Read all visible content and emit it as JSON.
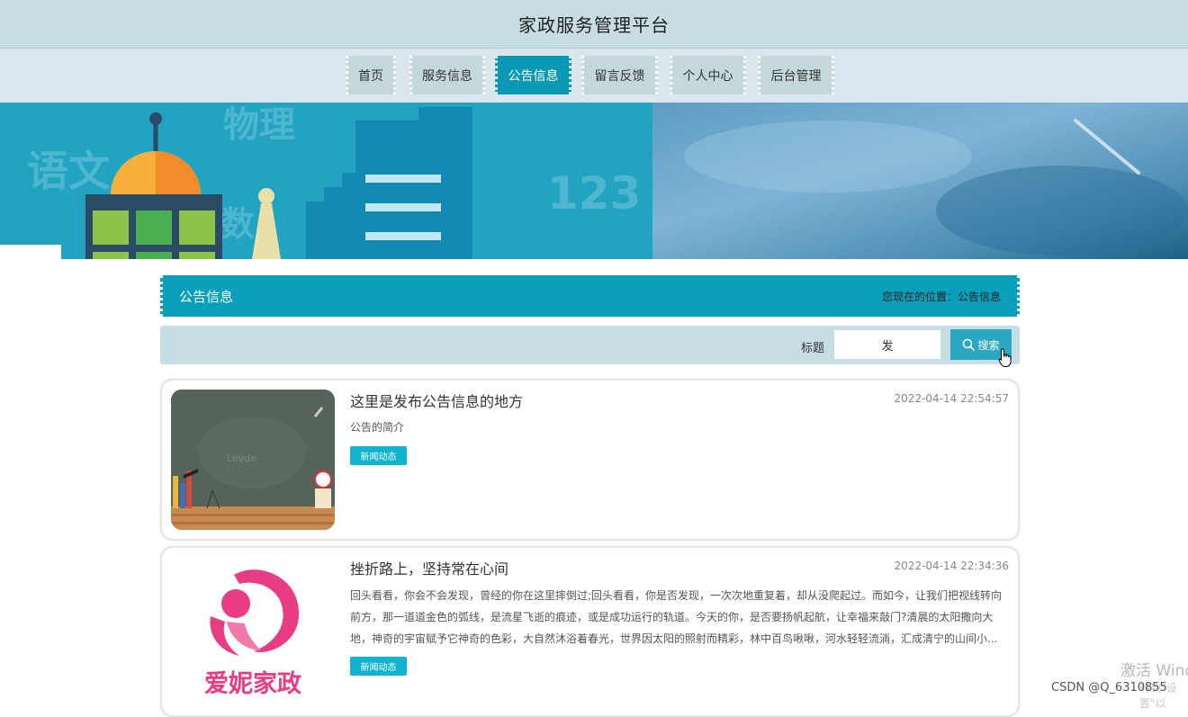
{
  "header": {
    "title": "家政服务管理平台"
  },
  "nav": {
    "items": [
      {
        "label": "首页",
        "active": false
      },
      {
        "label": "服务信息",
        "active": false
      },
      {
        "label": "公告信息",
        "active": true
      },
      {
        "label": "留言反馈",
        "active": false
      },
      {
        "label": "个人中心",
        "active": false
      },
      {
        "label": "后台管理",
        "active": false
      }
    ]
  },
  "banner": {
    "words": [
      "语文",
      "物理",
      "数",
      "123"
    ]
  },
  "section": {
    "title": "公告信息",
    "breadcrumb": "您现在的位置：公告信息"
  },
  "search": {
    "label": "标题",
    "value": "发",
    "button_label": "搜索",
    "button_icon": "search-icon"
  },
  "list": [
    {
      "title": "这里是发布公告信息的地方",
      "time": "2022-04-14 22:54:57",
      "desc": "公告的简介",
      "tag": "新闻动态",
      "thumb": {
        "kind": "classroom-chalkboard",
        "text": "Lovde"
      }
    },
    {
      "title": "挫折路上，坚持常在心间",
      "time": "2022-04-14 22:34:36",
      "desc": "回头看看，你会不会发现，曾经的你在这里摔倒过;回头看看，你是否发现，一次次地重复着，却从没爬起过。而如今，让我们把视线转向前方，那一道道金色的弧线，是流星飞逝的痕迹，或是成功运行的轨道。今天的你，是否要扬帆起航，让幸福来敲门?清晨的太阳撒向大地，神奇的宇宙赋予它神奇的色彩，大自然沐浴着春光，世界因太阳的照射而精彩，林中百鸟啾啾，河水轻轻流淌，汇成清宁的山间小...",
      "tag": "新闻动态",
      "thumb": {
        "kind": "brand-logo",
        "text": "爱妮家政"
      }
    }
  ],
  "overlay": {
    "watermark": "激活 Wind",
    "watermark_sub": "转到\"设置\"以",
    "csdn": "CSDN @Q_6310855"
  },
  "colors": {
    "accent": "#0aa0bc",
    "nav_bg": "#d9e6ee",
    "header_bg": "#c8dde2",
    "tag": "#11b3cf",
    "logo_pink": "#e83d84"
  }
}
